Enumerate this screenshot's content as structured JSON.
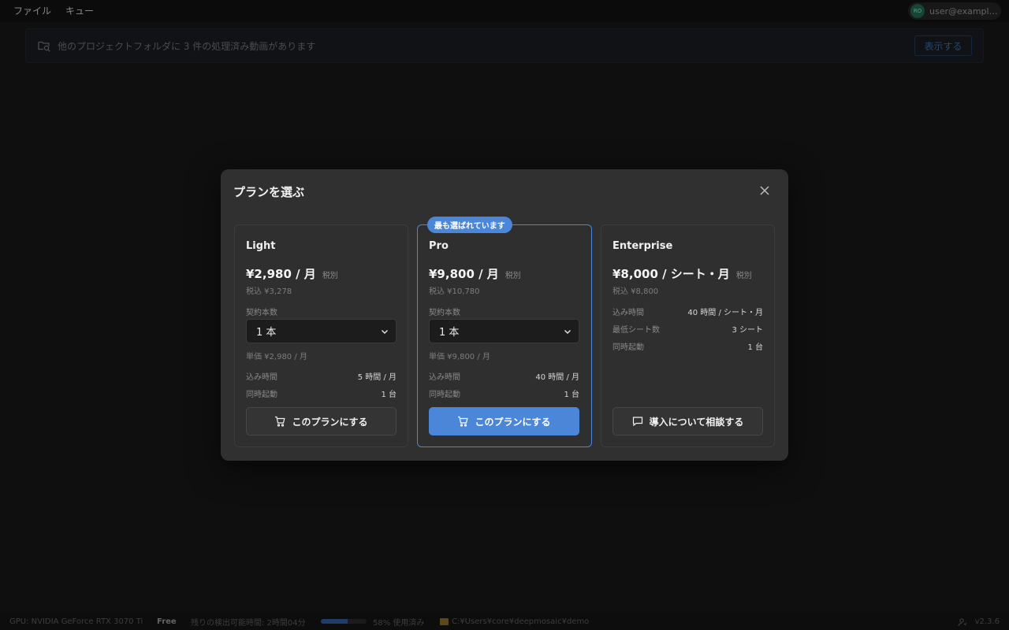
{
  "menubar": {
    "items": [
      "ファイル",
      "キュー"
    ],
    "account": {
      "initials": "RO",
      "email": "user@example...."
    }
  },
  "notice": {
    "text": "他のプロジェクトフォルダに 3 件の処理済み動画があります",
    "button": "表示する"
  },
  "modal": {
    "title": "プランを選ぶ",
    "plans": [
      {
        "name": "Light",
        "price": "¥2,980 / 月",
        "tax_label": "税別",
        "tax_included": "税込 ¥3,278",
        "contract_label": "契約本数",
        "contract_value": "1 本",
        "unit_price": "単価 ¥2,980 / 月",
        "features": [
          {
            "label": "込み時間",
            "value": "5 時間 / 月"
          },
          {
            "label": "同時起動",
            "value": "1 台"
          }
        ],
        "cta": "このプランにする"
      },
      {
        "name": "Pro",
        "badge": "最も選ばれています",
        "price": "¥9,800 / 月",
        "tax_label": "税別",
        "tax_included": "税込 ¥10,780",
        "contract_label": "契約本数",
        "contract_value": "1 本",
        "unit_price": "単価 ¥9,800 / 月",
        "features": [
          {
            "label": "込み時間",
            "value": "40 時間 / 月"
          },
          {
            "label": "同時起動",
            "value": "1 台"
          }
        ],
        "cta": "このプランにする"
      },
      {
        "name": "Enterprise",
        "price": "¥8,000 / シート・月",
        "tax_label": "税別",
        "tax_included": "税込 ¥8,800",
        "features": [
          {
            "label": "込み時間",
            "value": "40 時間 / シート・月"
          },
          {
            "label": "最低シート数",
            "value": "3 シート"
          },
          {
            "label": "同時起動",
            "value": "1 台"
          }
        ],
        "cta": "導入について相談する"
      }
    ]
  },
  "statusbar": {
    "gpu": "GPU: NVIDIA GeForce RTX 3070 Ti",
    "plan": "Free",
    "remaining": "残りの検出可能時間: 2時間04分",
    "usage_percent": 58,
    "usage_text": "58% 使用済み",
    "folder": "C:¥Users¥core¥deepmosaic¥demo",
    "version": "v2.3.6"
  },
  "colors": {
    "accent": "#4c86d8",
    "background": "#171717",
    "modal": "#303030"
  }
}
